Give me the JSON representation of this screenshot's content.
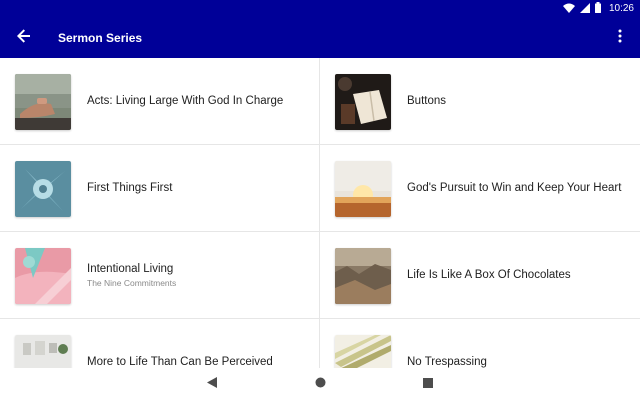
{
  "status_bar": {
    "time": "10:26",
    "icons": [
      "wifi-icon",
      "signal-icon",
      "battery-icon"
    ]
  },
  "app_bar": {
    "title": "Sermon Series",
    "back_icon": "arrow-back-icon",
    "menu_icon": "more-vert-icon"
  },
  "colors": {
    "primary": "#000098",
    "divider": "#e6e6e6",
    "subtitle": "#8a8a8a"
  },
  "series": [
    {
      "title": "Acts: Living Large With God In Charge",
      "subtitle": ""
    },
    {
      "title": "Buttons",
      "subtitle": ""
    },
    {
      "title": "First Things First",
      "subtitle": ""
    },
    {
      "title": "God's Pursuit to Win and Keep Your Heart",
      "subtitle": ""
    },
    {
      "title": "Intentional Living",
      "subtitle": "The Nine Commitments"
    },
    {
      "title": "Life Is Like A Box Of Chocolates",
      "subtitle": ""
    },
    {
      "title": "More to Life Than Can Be Perceived",
      "subtitle": ""
    },
    {
      "title": "No Trespassing",
      "subtitle": ""
    }
  ],
  "nav_bar": {
    "icons": [
      "back-triangle-icon",
      "home-circle-icon",
      "recents-square-icon"
    ]
  }
}
